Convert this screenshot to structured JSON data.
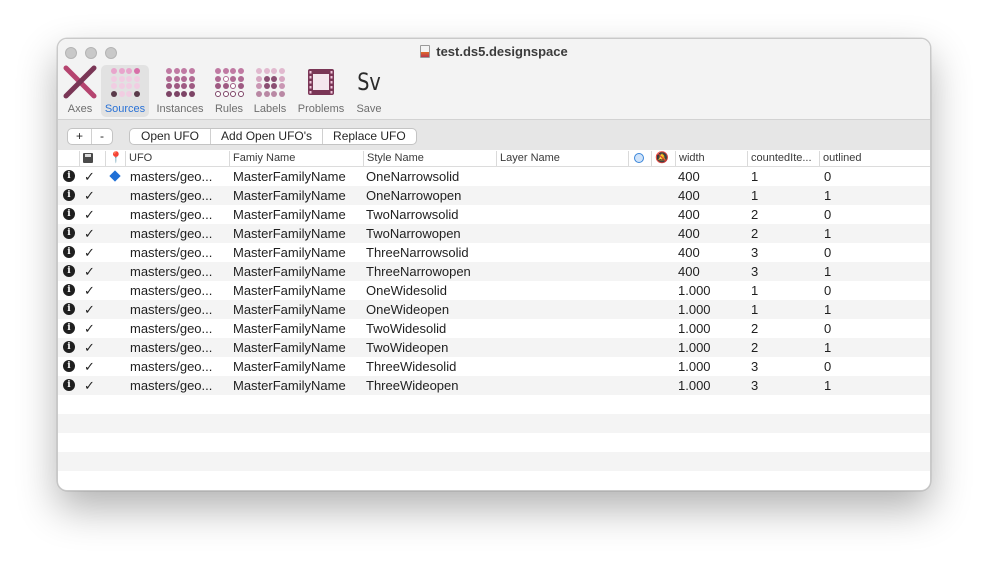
{
  "window": {
    "title": "test.ds5.designspace"
  },
  "toolbar": {
    "items": [
      {
        "label": "Axes",
        "icon": "axes-x-icon"
      },
      {
        "label": "Sources",
        "icon": "sources-grid-icon",
        "selected": true
      },
      {
        "label": "Instances",
        "icon": "instances-grid-icon"
      },
      {
        "label": "Rules",
        "icon": "rules-grid-icon"
      },
      {
        "label": "Labels",
        "icon": "labels-grid-icon"
      },
      {
        "label": "Problems",
        "icon": "problems-film-icon"
      },
      {
        "label": "Save",
        "icon": "save-sv-icon",
        "glyph": "Sv"
      }
    ]
  },
  "actions": {
    "add": "+",
    "remove": "-",
    "open_ufo": "Open UFO",
    "add_open_ufos": "Add Open UFO's",
    "replace_ufo": "Replace UFO"
  },
  "columns": {
    "ufo": "UFO",
    "family": "Famiy Name",
    "style": "Style Name",
    "layer": "Layer Name",
    "width": "width",
    "counted": "countedIte...",
    "outlined": "outlined"
  },
  "rows": [
    {
      "ufo": "masters/geo...",
      "family": "MasterFamilyName",
      "style": "OneNarrowsolid",
      "width": "400",
      "counted": "1",
      "outlined": "0",
      "check": "✓",
      "default": true
    },
    {
      "ufo": "masters/geo...",
      "family": "MasterFamilyName",
      "style": "OneNarrowopen",
      "width": "400",
      "counted": "1",
      "outlined": "1",
      "check": "✓"
    },
    {
      "ufo": "masters/geo...",
      "family": "MasterFamilyName",
      "style": "TwoNarrowsolid",
      "width": "400",
      "counted": "2",
      "outlined": "0",
      "check": "✓"
    },
    {
      "ufo": "masters/geo...",
      "family": "MasterFamilyName",
      "style": "TwoNarrowopen",
      "width": "400",
      "counted": "2",
      "outlined": "1",
      "check": "✓"
    },
    {
      "ufo": "masters/geo...",
      "family": "MasterFamilyName",
      "style": "ThreeNarrowsolid",
      "width": "400",
      "counted": "3",
      "outlined": "0",
      "check": "✓"
    },
    {
      "ufo": "masters/geo...",
      "family": "MasterFamilyName",
      "style": "ThreeNarrowopen",
      "width": "400",
      "counted": "3",
      "outlined": "1",
      "check": "✓"
    },
    {
      "ufo": "masters/geo...",
      "family": "MasterFamilyName",
      "style": "OneWidesolid",
      "width": "1.000",
      "counted": "1",
      "outlined": "0",
      "check": "✓"
    },
    {
      "ufo": "masters/geo...",
      "family": "MasterFamilyName",
      "style": "OneWideopen",
      "width": "1.000",
      "counted": "1",
      "outlined": "1",
      "check": "✓"
    },
    {
      "ufo": "masters/geo...",
      "family": "MasterFamilyName",
      "style": "TwoWidesolid",
      "width": "1.000",
      "counted": "2",
      "outlined": "0",
      "check": "✓"
    },
    {
      "ufo": "masters/geo...",
      "family": "MasterFamilyName",
      "style": "TwoWideopen",
      "width": "1.000",
      "counted": "2",
      "outlined": "1",
      "check": "✓"
    },
    {
      "ufo": "masters/geo...",
      "family": "MasterFamilyName",
      "style": "ThreeWidesolid",
      "width": "1.000",
      "counted": "3",
      "outlined": "0",
      "check": "✓"
    },
    {
      "ufo": "masters/geo...",
      "family": "MasterFamilyName",
      "style": "ThreeWideopen",
      "width": "1.000",
      "counted": "3",
      "outlined": "1",
      "check": "✓"
    }
  ],
  "colors": {
    "selected_label": "#2a72d6",
    "default_marker": "#1f6fd6",
    "axes_icon": "#b5446f",
    "grid_pink": "#e89ac4",
    "grid_dark": "#5a3a4a"
  }
}
